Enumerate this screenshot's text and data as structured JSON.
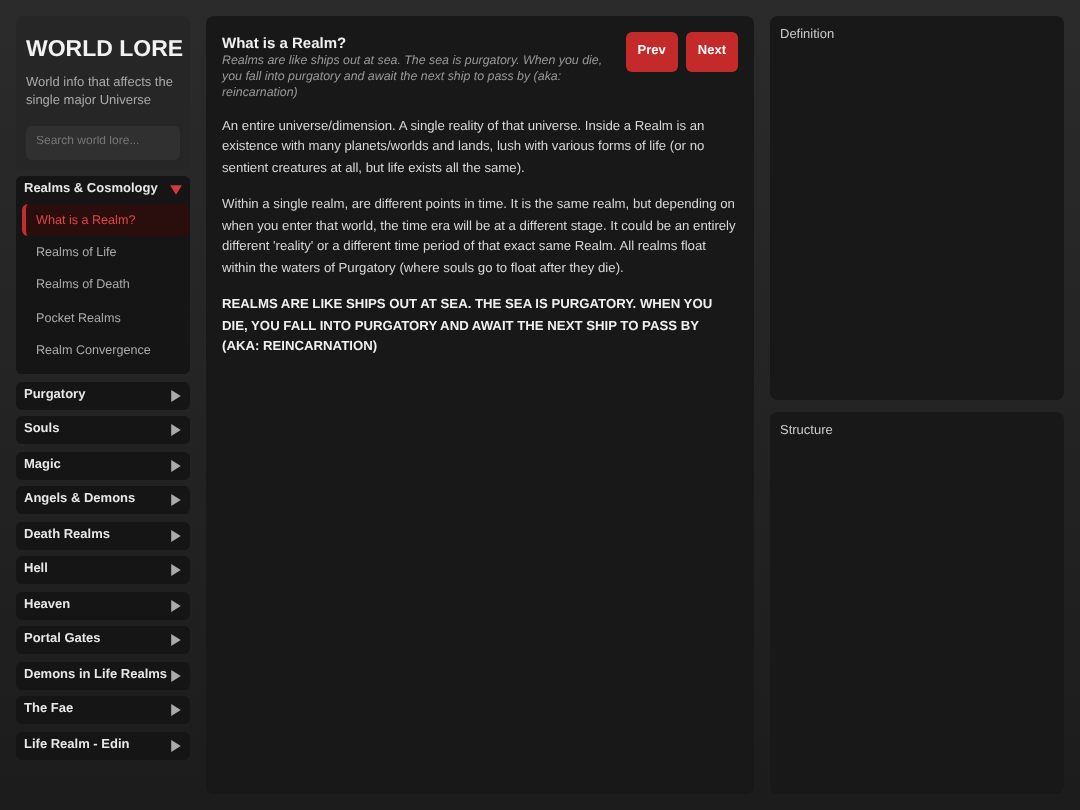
{
  "sidebar": {
    "title": "WORLD LORE",
    "subtitle": "World info that affects the single major Universe",
    "search": {
      "placeholder": "Search world lore..."
    },
    "categories": [
      {
        "label": "Realms & Cosmology",
        "expanded": true,
        "children": [
          {
            "label": "What is a Realm?",
            "selected": true
          },
          {
            "label": "Realms of Life",
            "selected": false
          },
          {
            "label": "Realms of Death",
            "selected": false
          },
          {
            "label": "Pocket Realms",
            "selected": false
          },
          {
            "label": "Realm Convergence",
            "selected": false
          }
        ]
      },
      {
        "label": "Purgatory",
        "expanded": false
      },
      {
        "label": "Souls",
        "expanded": false
      },
      {
        "label": "Magic",
        "expanded": false
      },
      {
        "label": "Angels & Demons",
        "expanded": false
      },
      {
        "label": "Death Realms",
        "expanded": false
      },
      {
        "label": "Hell",
        "expanded": false
      },
      {
        "label": "Heaven",
        "expanded": false
      },
      {
        "label": "Portal Gates",
        "expanded": false
      },
      {
        "label": "Demons in Life Realms",
        "expanded": false
      },
      {
        "label": "The Fae",
        "expanded": false
      },
      {
        "label": "Life Realm - Edin",
        "expanded": false
      }
    ]
  },
  "article": {
    "title": "What is a Realm?",
    "summary": "Realms are like ships out at sea. The sea is purgatory. When you die, you fall into purgatory and await the next ship to pass by (aka: reincarnation)",
    "buttons": [
      "Prev",
      "Next"
    ],
    "paragraphs": [
      {
        "kind": "normal",
        "text": "An entire universe/dimension. A single reality of that universe. Inside a Realm is an existence with many planets/worlds and lands, lush with various forms of life (or no sentient creatures at all, but life exists all the same)."
      },
      {
        "kind": "normal",
        "text": "Within a single realm, are different points in time. It is the same realm, but depending on when you enter that world, the time era will be at a different stage. It could be an entirely different 'reality' or a different time period of that exact same Realm. All realms float within the waters of Purgatory (where souls go to float after they die)."
      },
      {
        "kind": "emphasis",
        "text": "REALMS ARE LIKE SHIPS OUT AT SEA. THE SEA IS PURGATORY. WHEN YOU DIE, YOU FALL INTO PURGATORY AND AWAIT THE NEXT SHIP TO PASS BY (AKA: REINCARNATION)"
      }
    ]
  },
  "panels": [
    {
      "title": "Definition"
    },
    {
      "title": "Structure"
    }
  ]
}
